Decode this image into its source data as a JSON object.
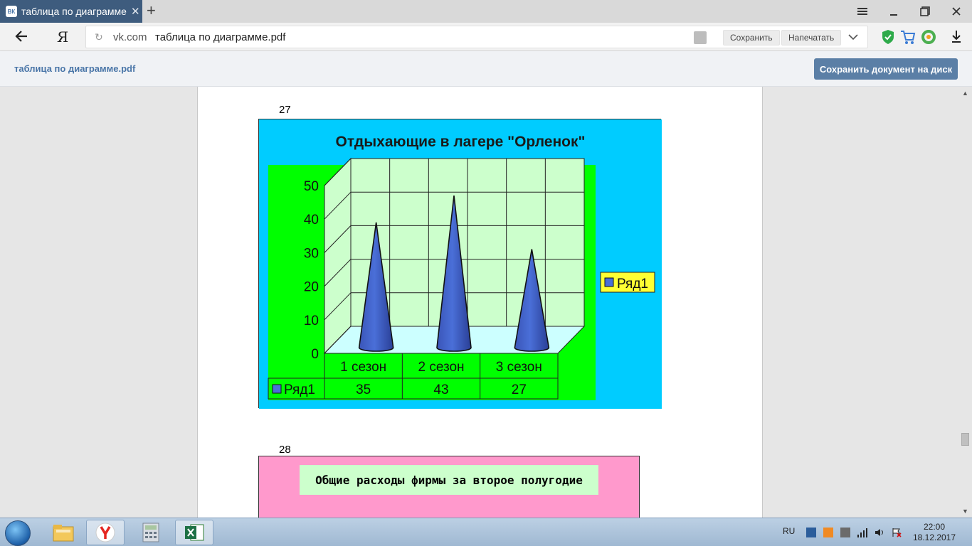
{
  "browser": {
    "tab_title": "таблица по диаграмме.р",
    "tab_favicon": "ВК",
    "domain": "vk.com",
    "url_path": "таблица по диаграмме.pdf",
    "yandex_logo": "Я",
    "save_label": "Сохранить",
    "print_label": "Напечатать"
  },
  "doc_header": {
    "filename": "таблица по диаграмме.pdf",
    "save_to_disk": "Сохранить документ на диск"
  },
  "page": {
    "page_number_1": "27",
    "page_number_2": "28"
  },
  "chart_data": [
    {
      "type": "bar",
      "title": "Отдыхающие в лагере \"Орленок\"",
      "categories": [
        "1 сезон",
        "2 сезон",
        "3 сезон"
      ],
      "series": [
        {
          "name": "Ряд1",
          "values": [
            35,
            43,
            27
          ]
        }
      ],
      "ylim": [
        0,
        50
      ],
      "yticks": [
        "0",
        "10",
        "20",
        "30",
        "40",
        "50"
      ],
      "grid": true,
      "legend": "right",
      "data_table": true,
      "colors": {
        "background": "#00ccff",
        "plot_area": "#00ff00",
        "walls": "#ccffcc",
        "cone": "#4a6fd8",
        "legend_bg": "#ffff33"
      }
    },
    {
      "type": "bar",
      "title": "Общие расходы фирмы за второе полугодие",
      "colors": {
        "background": "#ff99cc",
        "title_bg": "#ccffcc"
      }
    }
  ],
  "taskbar": {
    "lang": "RU",
    "time": "22:00",
    "date": "18.12.2017"
  }
}
